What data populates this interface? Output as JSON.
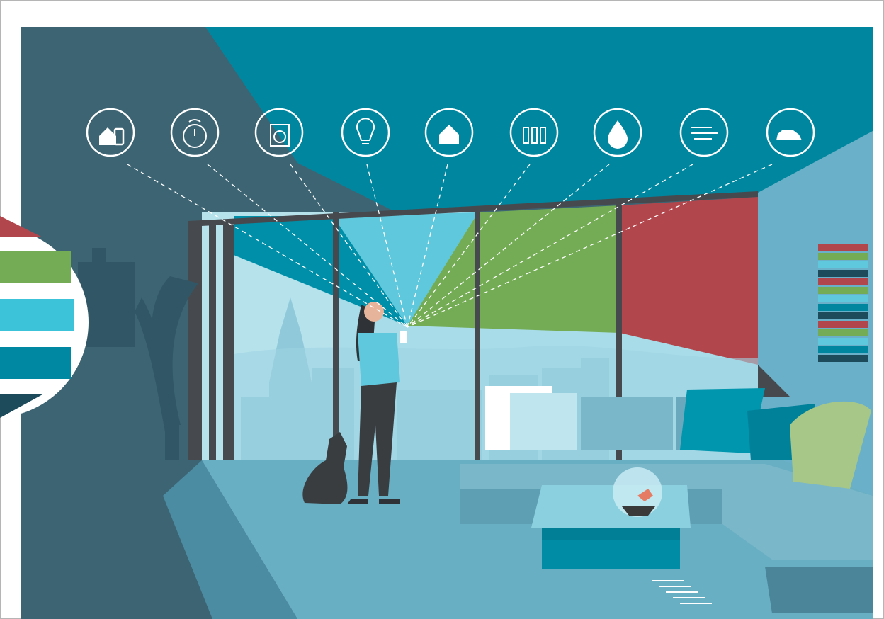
{
  "illustration": {
    "icons": [
      {
        "name": "smart-home-phone-icon"
      },
      {
        "name": "smart-thermostat-icon"
      },
      {
        "name": "smart-washing-machine-icon"
      },
      {
        "name": "smart-bulb-icon"
      },
      {
        "name": "wifi-home-icon"
      },
      {
        "name": "lab-test-tubes-icon"
      },
      {
        "name": "water-drop-wifi-icon"
      },
      {
        "name": "air-flow-icon"
      },
      {
        "name": "electric-car-charging-icon"
      }
    ],
    "colors": {
      "background_dark": "#3d6473",
      "ceiling_teal": "#00869f",
      "window_red": "#b1474d",
      "window_green": "#74ac55",
      "window_sky": "#5fc8dc",
      "floor_blue": "#6aaec4",
      "sofa": "#79b7c9",
      "accent_light_green": "#a7c788",
      "navy": "#1d4b5b"
    }
  }
}
